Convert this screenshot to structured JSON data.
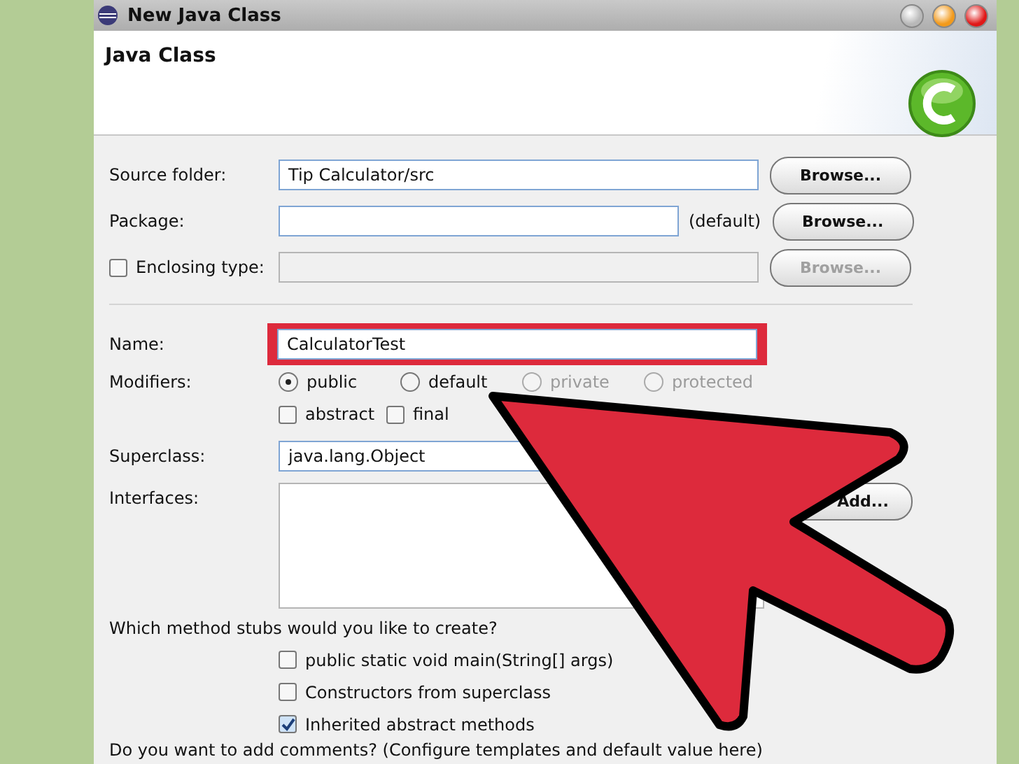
{
  "window": {
    "title": "New Java Class"
  },
  "header": {
    "title": "Java Class"
  },
  "source_folder": {
    "label": "Source folder:",
    "value": "Tip Calculator/src",
    "button": {
      "label": "Browse...",
      "disabled": false
    }
  },
  "package": {
    "label": "Package:",
    "suffix": "(default)",
    "button": {
      "label": "Browse...",
      "disabled": false
    }
  },
  "enclosing_type": {
    "label": "Enclosing type:",
    "checked": false,
    "disabled": true,
    "button": {
      "label": "Browse...",
      "disabled": true
    }
  },
  "name": {
    "label": "Name:",
    "value": "CalculatorTest",
    "highlighted": true
  },
  "modifiers": {
    "label": "Modifiers:",
    "options": [
      {
        "label": "public",
        "selected": true,
        "disabled": false
      },
      {
        "label": "default",
        "selected": false,
        "disabled": false
      },
      {
        "label": "private",
        "selected": false,
        "disabled": true
      },
      {
        "label": "protected",
        "selected": false,
        "disabled": true
      }
    ],
    "flags": [
      {
        "label": "abstract",
        "checked": false
      },
      {
        "label": "final",
        "checked": false
      }
    ]
  },
  "superclass": {
    "label": "Superclass:",
    "value": "java.lang.Object"
  },
  "interfaces": {
    "label": "Interfaces:",
    "button": {
      "label": "Add...",
      "disabled": false
    }
  },
  "stubs": {
    "question": "Which method stubs would you like to create?",
    "options": [
      {
        "label": "public static void main(String[] args)",
        "checked": false
      },
      {
        "label": "Constructors from superclass",
        "checked": false
      },
      {
        "label": "Inherited abstract methods",
        "checked": true
      }
    ]
  },
  "comments": {
    "question": "Do you want to add comments? (Configure templates and default value here)"
  }
}
